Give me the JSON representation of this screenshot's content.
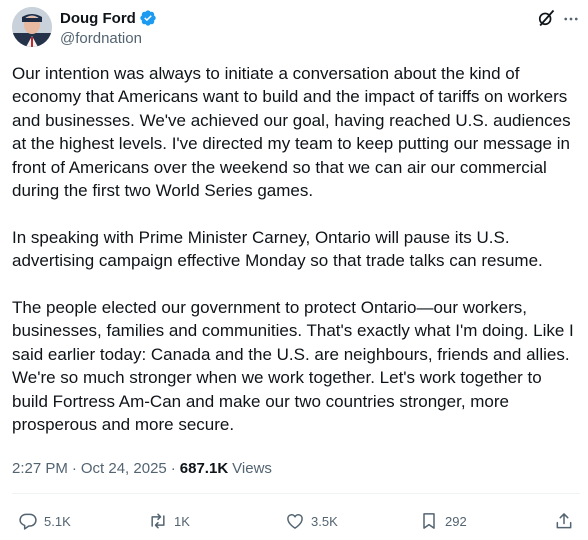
{
  "author": {
    "name": "Doug Ford",
    "handle": "@fordnation",
    "verified_color": "#1d9bf0"
  },
  "tweet": {
    "paragraphs": [
      "Our intention was always to initiate a conversation about the kind of economy that Americans want to build and the impact of tariffs on workers and businesses. We've achieved our goal, having reached U.S. audiences at the highest levels. I've directed my team to keep putting our message in front of Americans over the weekend so that we can air our commercial during the first two World Series games.",
      "In speaking with Prime Minister Carney, Ontario will pause its U.S. advertising campaign effective Monday so that trade talks can resume.",
      "The people elected our government to protect Ontario—our workers, businesses, families and communities. That's exactly what I'm doing. Like I said earlier today: Canada and the U.S. are neighbours, friends and allies. We're so much stronger when we work together. Let's work together to build Fortress Am-Can and make our two countries stronger, more prosperous and more secure."
    ],
    "time": "2:27 PM",
    "date": "Oct 24, 2025",
    "separator": "·",
    "views_count": "687.1K",
    "views_label": "Views"
  },
  "actions": {
    "replies": "5.1K",
    "retweets": "1K",
    "likes": "3.5K",
    "bookmarks": "292"
  },
  "icons": {
    "header_right": [
      "grok-icon",
      "more-icon"
    ],
    "actions": [
      "reply-icon",
      "retweet-icon",
      "like-icon",
      "bookmark-icon",
      "share-icon"
    ]
  },
  "colors": {
    "text": "#0f1419",
    "secondary": "#536471",
    "divider": "#eff3f4"
  }
}
